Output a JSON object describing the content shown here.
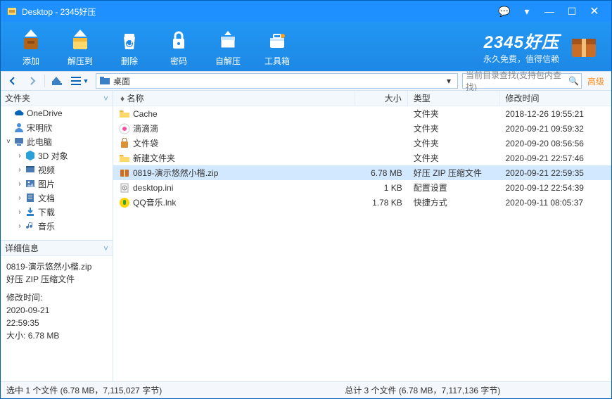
{
  "title": "Desktop - 2345好压",
  "toolbar": [
    {
      "id": "add",
      "label": "添加"
    },
    {
      "id": "extract",
      "label": "解压到"
    },
    {
      "id": "delete",
      "label": "删除"
    },
    {
      "id": "password",
      "label": "密码"
    },
    {
      "id": "sfx",
      "label": "自解压"
    },
    {
      "id": "toolbox",
      "label": "工具箱"
    }
  ],
  "brand": {
    "main": "2345好压",
    "sub": "永久免费，值得信赖"
  },
  "path": {
    "label": "桌面"
  },
  "search": {
    "placeholder": "当前目录查找(支持包内查找)"
  },
  "adv_label": "高级",
  "panes": {
    "folders": "文件夹",
    "details": "详细信息"
  },
  "tree": [
    {
      "indent": 0,
      "exp": "",
      "icon": "cloud",
      "label": "OneDrive",
      "color": "#0364b8"
    },
    {
      "indent": 0,
      "exp": "",
      "icon": "user",
      "label": "宋明欣",
      "color": "#4a90d9"
    },
    {
      "indent": 0,
      "exp": "˅",
      "icon": "pc",
      "label": "此电脑",
      "color": "#4a7bb5"
    },
    {
      "indent": 1,
      "exp": "›",
      "icon": "cube",
      "label": "3D 对象",
      "color": "#2aa0d8"
    },
    {
      "indent": 1,
      "exp": "›",
      "icon": "video",
      "label": "视频",
      "color": "#4a7bb5"
    },
    {
      "indent": 1,
      "exp": "›",
      "icon": "image",
      "label": "图片",
      "color": "#4a7bb5"
    },
    {
      "indent": 1,
      "exp": "›",
      "icon": "doc",
      "label": "文档",
      "color": "#4a7bb5"
    },
    {
      "indent": 1,
      "exp": "›",
      "icon": "download",
      "label": "下载",
      "color": "#2c82c9"
    },
    {
      "indent": 1,
      "exp": "›",
      "icon": "music",
      "label": "音乐",
      "color": "#4a7bb5"
    }
  ],
  "details": {
    "name": "0819-演示悠然小楷.zip",
    "type": "好压 ZIP 压缩文件",
    "mod_label": "修改时间:",
    "mod_date": "2020-09-21",
    "mod_time": "22:59:35",
    "size_label": "大小:",
    "size": "6.78 MB"
  },
  "columns": {
    "name": "名称",
    "size": "大小",
    "type": "类型",
    "mod": "修改时间"
  },
  "files": [
    {
      "icon": "folder",
      "name": "Cache",
      "size": "",
      "type": "文件夹",
      "mod": "2018-12-26 19:55:21",
      "sel": false
    },
    {
      "icon": "didi",
      "name": "滴滴滴",
      "size": "",
      "type": "文件夹",
      "mod": "2020-09-21 09:59:32",
      "sel": false
    },
    {
      "icon": "bag",
      "name": "文件袋",
      "size": "",
      "type": "文件夹",
      "mod": "2020-09-20 08:56:56",
      "sel": false
    },
    {
      "icon": "folder",
      "name": "新建文件夹",
      "size": "",
      "type": "文件夹",
      "mod": "2020-09-21 22:57:46",
      "sel": false
    },
    {
      "icon": "zip",
      "name": "0819-演示悠然小楷.zip",
      "size": "6.78 MB",
      "type": "好压 ZIP 压缩文件",
      "mod": "2020-09-21 22:59:35",
      "sel": true
    },
    {
      "icon": "ini",
      "name": "desktop.ini",
      "size": "1 KB",
      "type": "配置设置",
      "mod": "2020-09-12 22:54:39",
      "sel": false
    },
    {
      "icon": "qq",
      "name": "QQ音乐.lnk",
      "size": "1.78 KB",
      "type": "快捷方式",
      "mod": "2020-09-11 08:05:37",
      "sel": false
    }
  ],
  "status": {
    "left": "选中 1 个文件  (6.78 MB，7,115,027 字节)",
    "right": "总计 3 个文件  (6.78 MB，7,117,136 字节)"
  }
}
